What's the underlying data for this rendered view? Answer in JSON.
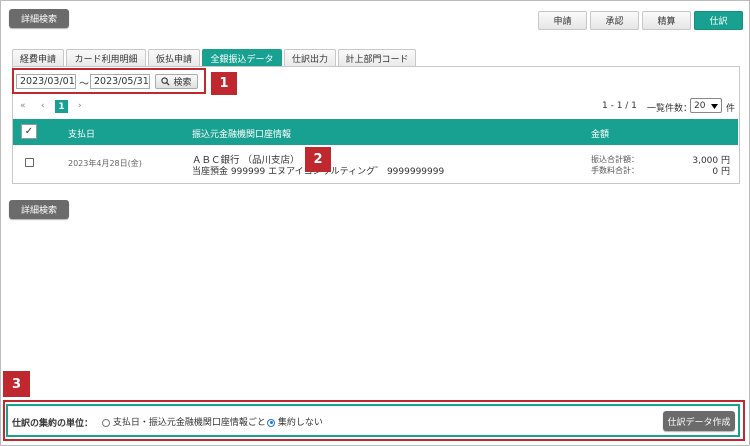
{
  "buttons": {
    "detail_search": "詳細検索",
    "detail_search_bottom": "詳細検索",
    "create_journal": "仕訳データ作成",
    "search": "検索"
  },
  "topnav": [
    {
      "label": "申請"
    },
    {
      "label": "承認"
    },
    {
      "label": "精算"
    },
    {
      "label": "仕訳",
      "active": true
    }
  ],
  "tabs": [
    {
      "label": "経費申請"
    },
    {
      "label": "カード利用明細"
    },
    {
      "label": "仮払申請"
    },
    {
      "label": "全銀振込データ",
      "active": true
    },
    {
      "label": "仕訳出力"
    },
    {
      "label": "計上部門コード"
    }
  ],
  "filter": {
    "date_from": "2023/03/01",
    "separator": "〜",
    "date_to": "2023/05/31"
  },
  "badges": [
    "1",
    "2",
    "3"
  ],
  "pager": {
    "first": "«",
    "prev": "‹",
    "page": "1",
    "next": "›",
    "range": "1 - 1 / 1",
    "per_page_label": "一覧件数：",
    "per_page_value": "20",
    "per_page_unit": "件"
  },
  "table": {
    "headers": {
      "check": "✓",
      "date": "支払日",
      "account": "振込元金融機関口座情報",
      "amount": "金額"
    },
    "rows": [
      {
        "date": "2023年4月28日(金)",
        "bank": "ＡＢＣ銀行 （品川支店）",
        "account": "当座預金 999999 エヌアイコンサルティング゛ 9999999999",
        "transfer_label": "振込合計額：",
        "transfer_value": "3,000 円",
        "fee_label": "手数料合計：",
        "fee_value": "0 円"
      }
    ]
  },
  "aggregation": {
    "label": "仕訳の集約の単位：",
    "option1": "支払日・振込元金融機関口座情報ごと",
    "option2": "集約しない",
    "selected": "option2"
  },
  "colors": {
    "accent": "#18a191",
    "highlight": "#c0282f"
  }
}
